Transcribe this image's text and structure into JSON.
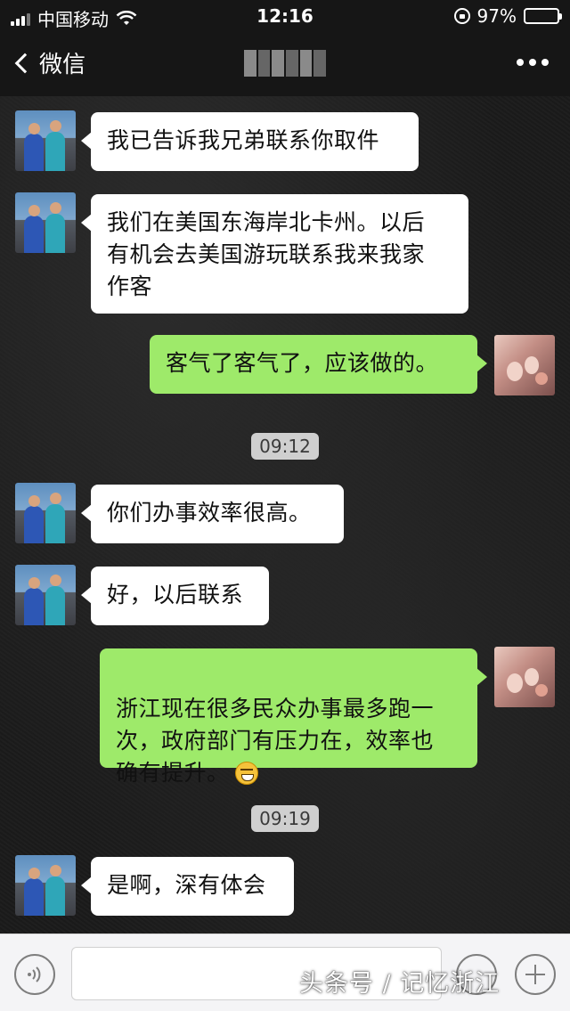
{
  "status_bar": {
    "carrier": "中国移动",
    "time": "12:16",
    "battery": "97%",
    "battery_level": 0.97
  },
  "nav": {
    "back_label": "微信"
  },
  "messages": [
    {
      "side": "left",
      "text": "我已告诉我兄弟联系你取件"
    },
    {
      "side": "left",
      "text": "我们在美国东海岸北卡州。以后\n有机会去美国游玩联系我来我家\n作客"
    },
    {
      "side": "right",
      "text": "客气了客气了，应该做的。"
    },
    {
      "side": "time",
      "text": "09:12"
    },
    {
      "side": "left",
      "text": "你们办事效率很高。"
    },
    {
      "side": "left",
      "text": "好，以后联系"
    },
    {
      "side": "right",
      "text": "浙江现在很多民众办事最多跑一\n次，政府部门有压力在，效率也\n确有提升。",
      "emoji": "grinning-emoji"
    },
    {
      "side": "time",
      "text": "09:19"
    },
    {
      "side": "left",
      "text": "是啊，深有体会"
    }
  ],
  "input_bar": {
    "placeholder": ""
  },
  "watermark": "头条号 / 记忆浙江",
  "colors": {
    "bubble_self": "#9eea6a",
    "bubble_other": "#ffffff",
    "bar_dark": "#161616",
    "input_bg": "#f4f4f6"
  }
}
